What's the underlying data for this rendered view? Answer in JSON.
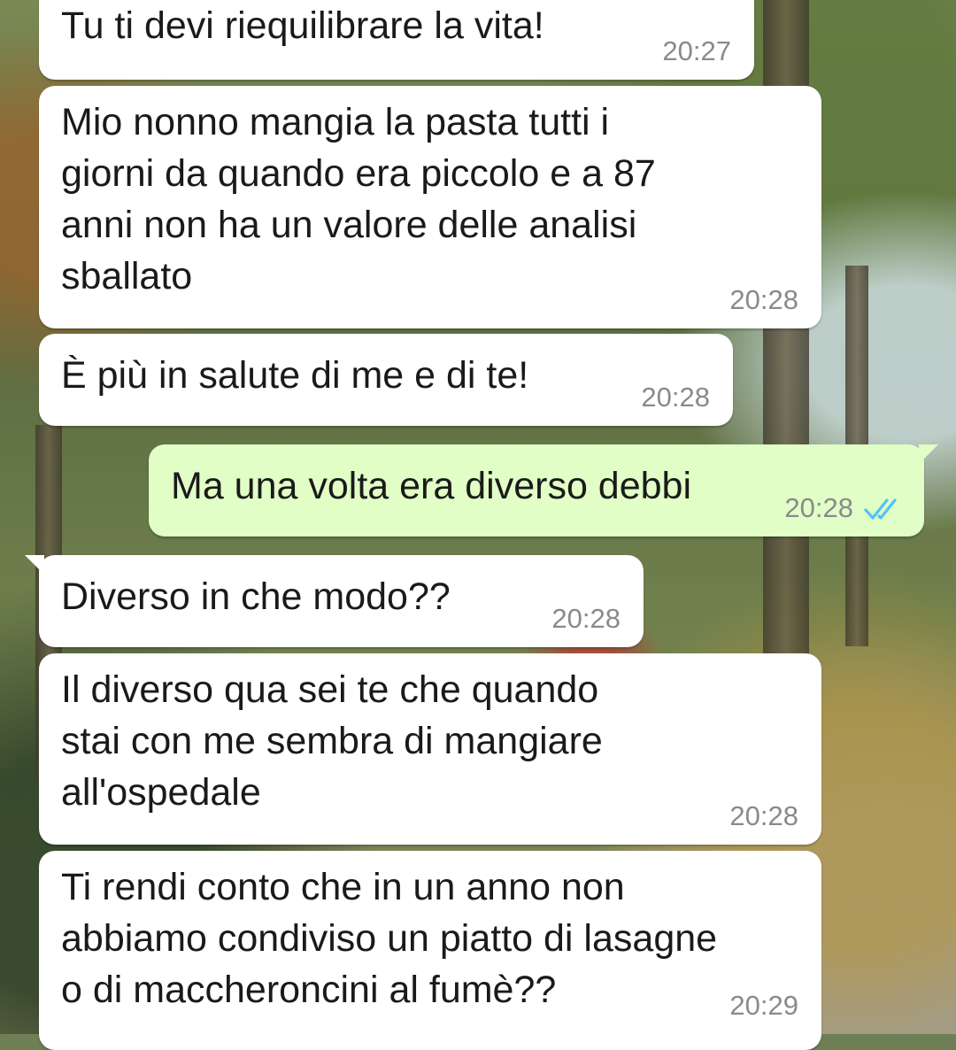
{
  "messages": [
    {
      "text": "Tu ti devi riequilibrare la vita!",
      "time": "20:27",
      "direction": "in"
    },
    {
      "text": "Mio nonno mangia la pasta tutti i\ngiorni da quando era piccolo e a 87\nanni non ha un valore delle analisi\nsballato",
      "time": "20:28",
      "direction": "in"
    },
    {
      "text": "È più in salute di me e di te!",
      "time": "20:28",
      "direction": "in"
    },
    {
      "text": "Ma una volta era diverso debbi",
      "time": "20:28",
      "direction": "out",
      "status_icon": "double-check-read-icon"
    },
    {
      "text": "Diverso in che modo??",
      "time": "20:28",
      "direction": "in"
    },
    {
      "text": "Il diverso qua sei te che quando\nstai con me sembra di mangiare\nall'ospedale",
      "time": "20:28",
      "direction": "in"
    },
    {
      "text": "Ti rendi conto che in un anno non\nabbiamo condiviso un piatto di lasagne\no di maccheroncini al fumè??",
      "time": "20:29",
      "direction": "in"
    }
  ],
  "colors": {
    "incoming_bubble": "#ffffff",
    "outgoing_bubble": "#e1fec6",
    "timestamp": "#8a8a8a",
    "read_ticks": "#4fc3f7"
  }
}
